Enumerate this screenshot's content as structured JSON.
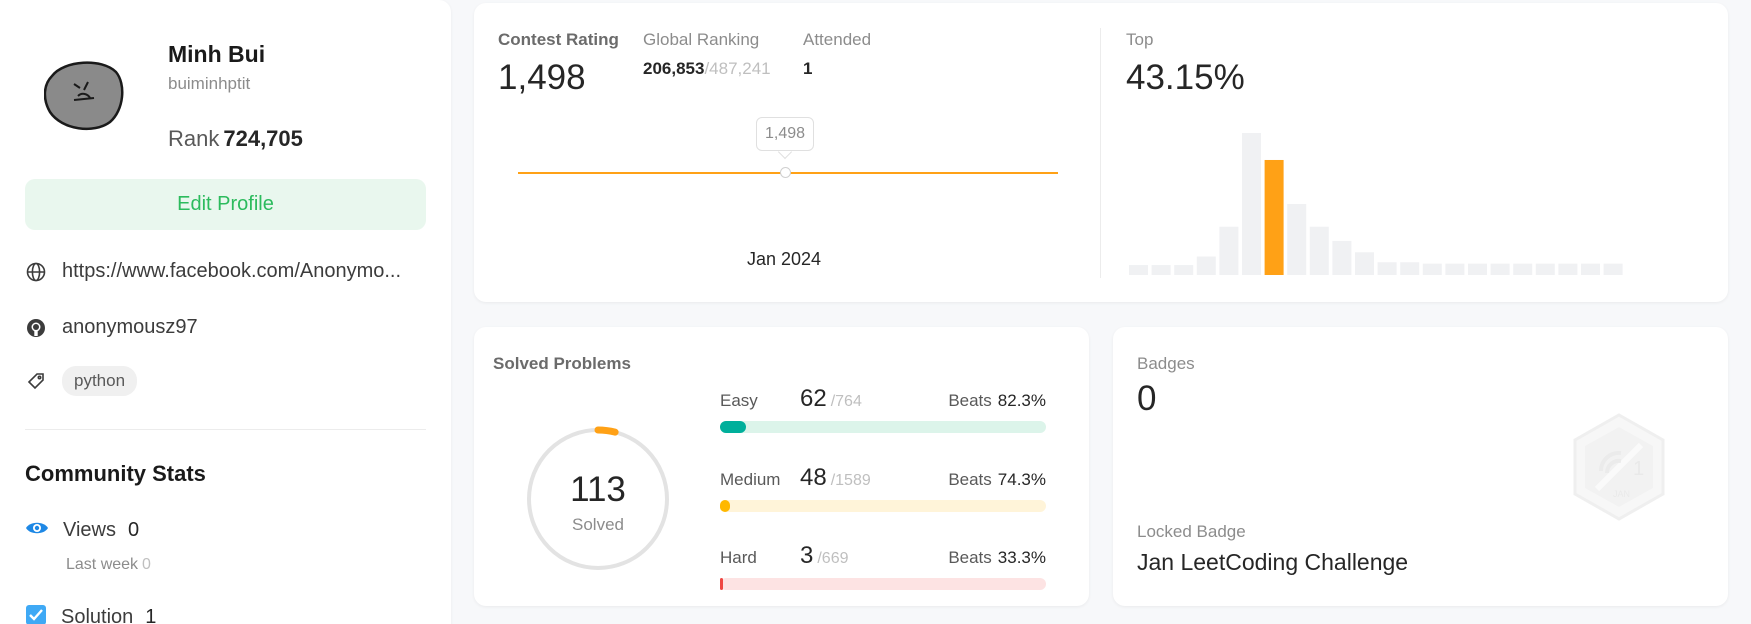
{
  "profile": {
    "name": "Minh Bui",
    "username": "buiminhptit",
    "rank_label": "Rank",
    "rank_value": "724,705",
    "edit_label": "Edit Profile",
    "website": "https://www.facebook.com/Anonymo...",
    "github": "anonymousz97",
    "skill_tag": "python"
  },
  "community": {
    "title": "Community Stats",
    "views_label": "Views",
    "views_value": "0",
    "last_week_label": "Last week",
    "last_week_value": "0",
    "solution_label": "Solution",
    "solution_value": "1"
  },
  "contest": {
    "rating_label": "Contest Rating",
    "rating_value": "1,498",
    "global_label": "Global Ranking",
    "global_value": "206,853",
    "global_total": "/487,241",
    "attended_label": "Attended",
    "attended_value": "1",
    "tooltip": "1,498",
    "x_label": "Jan 2024",
    "top_label": "Top",
    "top_value": "43.15%"
  },
  "chart_data": {
    "type": "bar",
    "values": [
      0.07,
      0.07,
      0.07,
      0.13,
      0.34,
      1.0,
      0.81,
      0.5,
      0.34,
      0.24,
      0.16,
      0.09,
      0.09,
      0.08,
      0.08,
      0.08,
      0.08,
      0.08,
      0.08,
      0.08,
      0.08,
      0.08
    ],
    "highlight_index": 6,
    "ylim": [
      0,
      1
    ]
  },
  "solved": {
    "title": "Solved Problems",
    "total": "113",
    "total_label": "Solved",
    "ring_fraction": 0.04,
    "difficulties": [
      {
        "label": "Easy",
        "solved": "62",
        "total": "/764",
        "beats_label": "Beats",
        "beats": "82.3%",
        "fraction": 0.081,
        "color": "#00af9b",
        "track": "#dcf4ea"
      },
      {
        "label": "Medium",
        "solved": "48",
        "total": "/1589",
        "beats_label": "Beats",
        "beats": "74.3%",
        "fraction": 0.03,
        "color": "#ffb800",
        "track": "#fff4d9"
      },
      {
        "label": "Hard",
        "solved": "3",
        "total": "/669",
        "beats_label": "Beats",
        "beats": "33.3%",
        "fraction": 0.0045,
        "color": "#ef4743",
        "track": "#fde3e3"
      }
    ]
  },
  "badges": {
    "title": "Badges",
    "count": "0",
    "locked_label": "Locked Badge",
    "locked_name": "Jan LeetCoding Challenge",
    "badge_text": "JAN",
    "badge_num": "1"
  },
  "colors": {
    "brand_green": "#2cbb5d",
    "accent_orange": "#ffa116",
    "easy": "#00af9b",
    "medium": "#ffb800",
    "hard": "#ef4743"
  }
}
